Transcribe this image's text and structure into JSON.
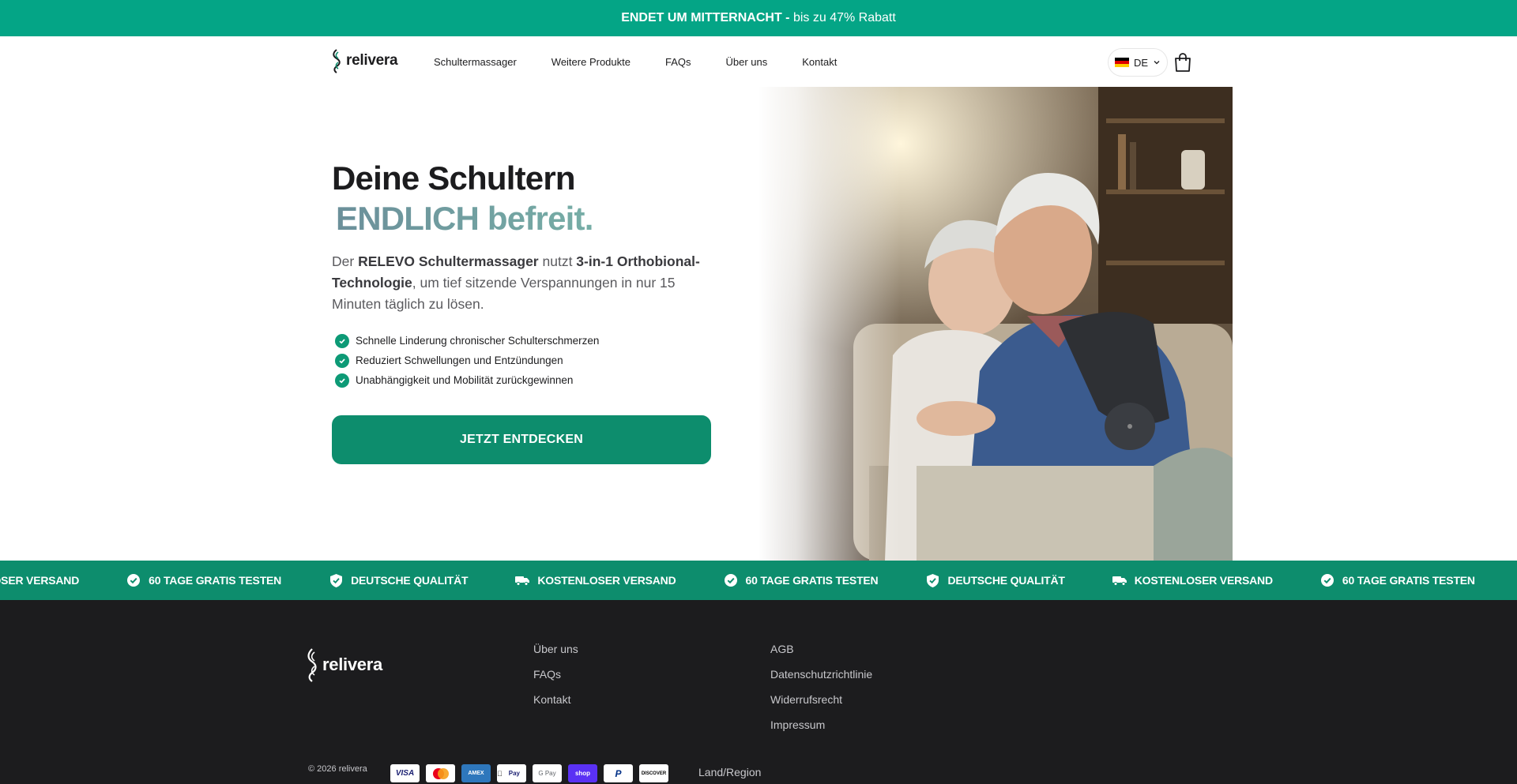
{
  "announcement": {
    "bold": "ENDET UM MITTERNACHT -",
    "text": " bis zu 47% Rabatt"
  },
  "header": {
    "logo_text": "relivera",
    "nav": [
      "Schultermassager",
      "Weitere Produkte",
      "FAQs",
      "Über uns",
      "Kontakt"
    ],
    "language": "DE",
    "icons": [
      "germany-flag-icon",
      "chevron-down-icon",
      "cart-icon"
    ]
  },
  "hero": {
    "title_line1": "Deine Schultern",
    "title_line2": "ENDLICH befreit.",
    "lead_1": "Der ",
    "lead_2": "RELEVO Schultermassager",
    "lead_3": " nutzt ",
    "lead_4": "3-in-1 Orthobional-Technologie",
    "lead_5": ", um tief sitzende Verspannungen in nur 15 Minuten täglich zu lösen.",
    "bullets": [
      "Schnelle Linderung chronischer Schulterschmerzen",
      "Reduziert Schwellungen und Entzündungen",
      "Unabhängigkeit und Mobilität zurückgewinnen"
    ],
    "cta": "JETZT ENTDECKEN"
  },
  "marquee": {
    "items": [
      {
        "label": "KOSTENLOSER VERSAND",
        "icon": "truck-icon"
      },
      {
        "label": "60 TAGE GRATIS TESTEN",
        "icon": "check-circle-icon"
      },
      {
        "label": "DEUTSCHE QUALITÄT",
        "icon": "shield-check-icon"
      },
      {
        "label": "KOSTENLOSER VERSAND",
        "icon": "truck-icon"
      },
      {
        "label": "60 TAGE GRATIS TESTEN",
        "icon": "check-circle-icon"
      },
      {
        "label": "DEUTSCHE QUALITÄT",
        "icon": "shield-check-icon"
      },
      {
        "label": "KOSTENLOSER VERSAND",
        "icon": "truck-icon"
      },
      {
        "label": "60 TAGE GRATIS TESTEN",
        "icon": "check-circle-icon"
      },
      {
        "label": "",
        "icon": "shield-check-icon"
      }
    ]
  },
  "footer": {
    "logo_text": "relivera",
    "col1": [
      "Über uns",
      "FAQs",
      "Kontakt"
    ],
    "col2": [
      "AGB",
      "Datenschutzrichtlinie",
      "Widerrufsrecht",
      "Impressum"
    ],
    "copyright": "© 2026 relivera",
    "payments": [
      "VISA",
      "",
      "AMEX",
      "Pay",
      "G Pay",
      "shop",
      "P",
      "DISCOVER"
    ],
    "region": "Land/Region"
  },
  "colors": {
    "accent": "#04a586",
    "button": "#0d8d6d",
    "footer_bg": "#1c1c1e"
  }
}
